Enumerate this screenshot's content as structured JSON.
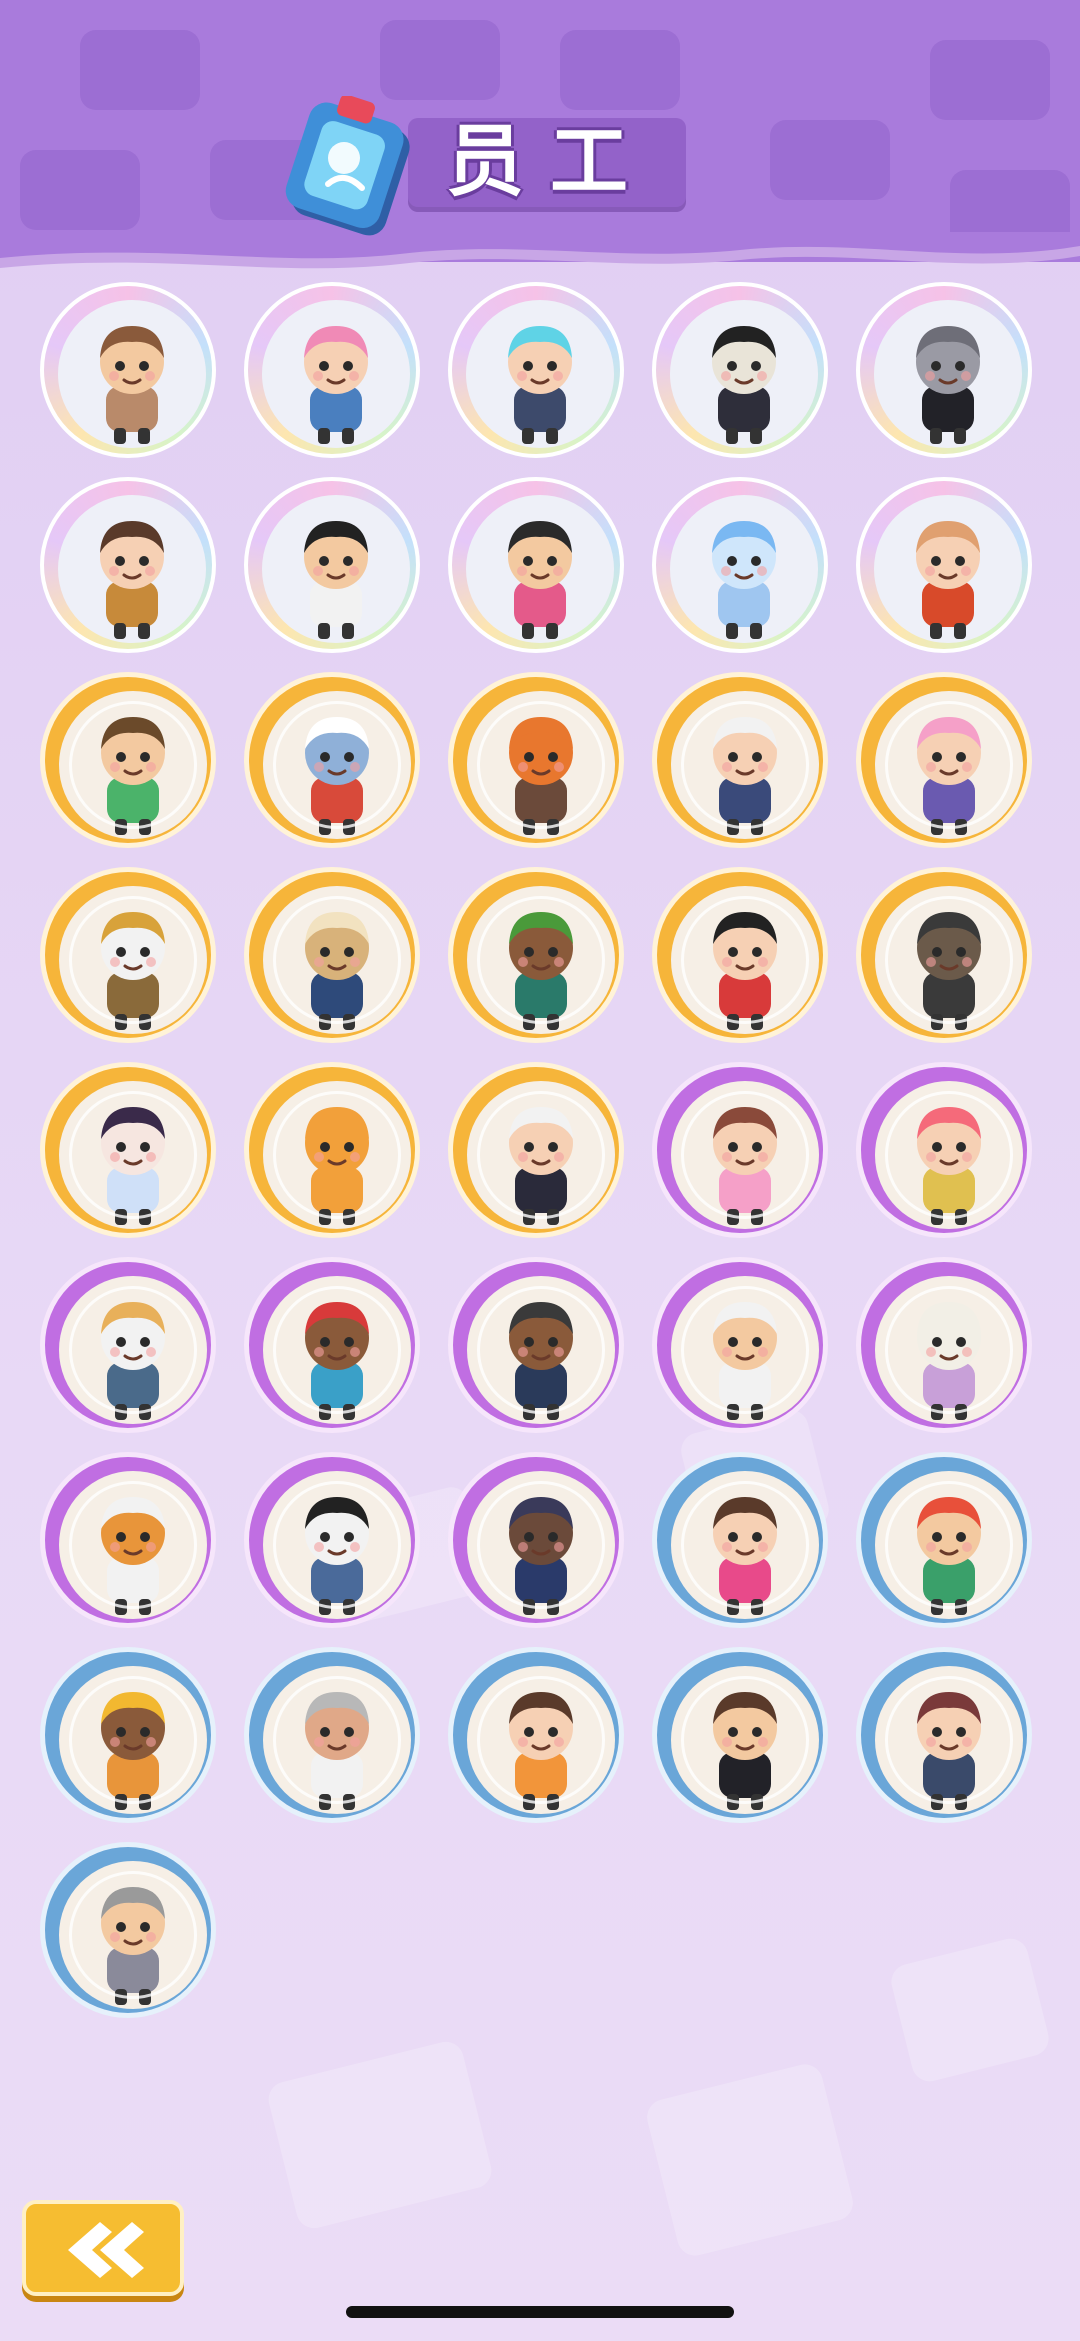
{
  "header": {
    "title": "员工",
    "icon": "staff-card-icon",
    "background_color": "#a97bdc"
  },
  "staff_grid": {
    "columns": 5,
    "items": [
      {
        "id": 1,
        "tier": "rainbow",
        "icon": "old-man-glasses-character",
        "skin": "#f3c9a0",
        "hair": "#8a5a3b",
        "outfit": "#b98a6a"
      },
      {
        "id": 2,
        "tier": "rainbow",
        "icon": "witch-girl-character",
        "skin": "#f6d0b4",
        "hair": "#f08ab6",
        "outfit": "#4a7fbf"
      },
      {
        "id": 3,
        "tier": "rainbow",
        "icon": "cyan-hair-swordsman-character",
        "skin": "#f6d0b4",
        "hair": "#5fd3e6",
        "outfit": "#3d4a6b"
      },
      {
        "id": 4,
        "tier": "rainbow",
        "icon": "jiangshi-character",
        "skin": "#e9e4d8",
        "hair": "#222222",
        "outfit": "#2e2e3a"
      },
      {
        "id": 5,
        "tier": "rainbow",
        "icon": "wolf-gentleman-character",
        "skin": "#9a9aa4",
        "hair": "#6e6e78",
        "outfit": "#222228"
      },
      {
        "id": 6,
        "tier": "rainbow",
        "icon": "cat-ear-girl-character",
        "skin": "#f6d0b4",
        "hair": "#5a3a2a",
        "outfit": "#c78a3a"
      },
      {
        "id": 7,
        "tier": "rainbow",
        "icon": "glasses-man-character",
        "skin": "#f3c9a0",
        "hair": "#222222",
        "outfit": "#f2f2f2"
      },
      {
        "id": 8,
        "tier": "rainbow",
        "icon": "bun-hair-chef-character",
        "skin": "#f3c9a0",
        "hair": "#2a2a2a",
        "outfit": "#e45a8a"
      },
      {
        "id": 9,
        "tier": "rainbow",
        "icon": "blue-ghost-girl-character",
        "skin": "#cfe6fb",
        "hair": "#7ab8f2",
        "outfit": "#9fc6f0"
      },
      {
        "id": 10,
        "tier": "rainbow",
        "icon": "twin-girls-character",
        "skin": "#f6d0b4",
        "hair": "#e0a070",
        "outfit": "#d84a2a"
      },
      {
        "id": 11,
        "tier": "gold",
        "icon": "elf-cloud-character",
        "skin": "#f3c9a0",
        "hair": "#6b4a2a",
        "outfit": "#4bb36a"
      },
      {
        "id": 12,
        "tier": "gold",
        "icon": "astronaut-fish-character",
        "skin": "#8fb0d8",
        "hair": "#ffffff",
        "outfit": "#d84a3a"
      },
      {
        "id": 13,
        "tier": "gold",
        "icon": "cooking-robot-character",
        "skin": "#e8772e",
        "hair": "#e8772e",
        "outfit": "#6b4a3a"
      },
      {
        "id": 14,
        "tier": "gold",
        "icon": "white-cat-girl-character",
        "skin": "#f6d0b4",
        "hair": "#f2f2f2",
        "outfit": "#3a4a7a"
      },
      {
        "id": 15,
        "tier": "gold",
        "icon": "pink-maid-character",
        "skin": "#f6d0b4",
        "hair": "#f5a0c8",
        "outfit": "#6a5ab0"
      },
      {
        "id": 16,
        "tier": "gold",
        "icon": "explorer-cat-character",
        "skin": "#f2f2f2",
        "hair": "#d8a23a",
        "outfit": "#8a6a3a"
      },
      {
        "id": 17,
        "tier": "gold",
        "icon": "fox-detective-character",
        "skin": "#d8b27a",
        "hair": "#f2e2c0",
        "outfit": "#2e4a7a"
      },
      {
        "id": 18,
        "tier": "gold",
        "icon": "bug-catcher-girl-character",
        "skin": "#8a5a3a",
        "hair": "#4a9a3a",
        "outfit": "#2a7a6a"
      },
      {
        "id": 19,
        "tier": "gold",
        "icon": "lion-dance-kid-character",
        "skin": "#f6d0b4",
        "hair": "#222222",
        "outfit": "#d83a3a"
      },
      {
        "id": 20,
        "tier": "gold",
        "icon": "bronze-statue-character",
        "skin": "#6b5a4a",
        "hair": "#3a3a3a",
        "outfit": "#3a3a3a"
      },
      {
        "id": 21,
        "tier": "gold",
        "icon": "umbrella-lady-character",
        "skin": "#f6e6e0",
        "hair": "#3a2a4a",
        "outfit": "#cfe0f8"
      },
      {
        "id": 22,
        "tier": "gold",
        "icon": "orange-robot-character",
        "skin": "#f2a03a",
        "hair": "#f2a03a",
        "outfit": "#f2a03a"
      },
      {
        "id": 23,
        "tier": "gold",
        "icon": "white-hair-boy-character",
        "skin": "#f6d0b4",
        "hair": "#f2f2f2",
        "outfit": "#2a2a3a"
      },
      {
        "id": 24,
        "tier": "purple",
        "icon": "ice-cream-girl-character",
        "skin": "#f6d0b4",
        "hair": "#8a4a3a",
        "outfit": "#f5a0c8"
      },
      {
        "id": 25,
        "tier": "purple",
        "icon": "pink-hair-girl-character",
        "skin": "#f6d0b4",
        "hair": "#f56a7a",
        "outfit": "#e0c050"
      },
      {
        "id": 26,
        "tier": "purple",
        "icon": "chef-cat-character",
        "skin": "#f2f2f2",
        "hair": "#e8b05a",
        "outfit": "#4a6a8a"
      },
      {
        "id": 27,
        "tier": "purple",
        "icon": "bandana-man-character",
        "skin": "#8a5a3a",
        "hair": "#d83a3a",
        "outfit": "#3aa0c8"
      },
      {
        "id": 28,
        "tier": "purple",
        "icon": "backpack-man-character",
        "skin": "#8a5a3a",
        "hair": "#3a3a3a",
        "outfit": "#2a3a5a"
      },
      {
        "id": 29,
        "tier": "purple",
        "icon": "chef-hat-man-character",
        "skin": "#f3c9a0",
        "hair": "#f2f2f2",
        "outfit": "#f2f2f2"
      },
      {
        "id": 30,
        "tier": "purple",
        "icon": "alpaca-character",
        "skin": "#f2efe6",
        "hair": "#f2efe6",
        "outfit": "#c8a0d8"
      },
      {
        "id": 31,
        "tier": "purple",
        "icon": "corgi-character",
        "skin": "#e8953a",
        "hair": "#f2f2f2",
        "outfit": "#f2f2f2"
      },
      {
        "id": 32,
        "tier": "purple",
        "icon": "panda-character",
        "skin": "#f2f2f2",
        "hair": "#222222",
        "outfit": "#4a6a9a"
      },
      {
        "id": 33,
        "tier": "purple",
        "icon": "otter-explorer-character",
        "skin": "#6b4a3a",
        "hair": "#3a3a5a",
        "outfit": "#2a3a6a"
      },
      {
        "id": 34,
        "tier": "blue",
        "icon": "curly-hair-woman-character",
        "skin": "#f6d0b4",
        "hair": "#5a3a2a",
        "outfit": "#e84a8a"
      },
      {
        "id": 35,
        "tier": "blue",
        "icon": "red-hair-boy-character",
        "skin": "#f3c9a0",
        "hair": "#e8503a",
        "outfit": "#3aa06a"
      },
      {
        "id": 36,
        "tier": "blue",
        "icon": "worker-boy-character",
        "skin": "#8a5a3a",
        "hair": "#f2b830",
        "outfit": "#e8953a"
      },
      {
        "id": 37,
        "tier": "blue",
        "icon": "old-man-cup-character",
        "skin": "#e0a888",
        "hair": "#b8b8b8",
        "outfit": "#f2f2f2"
      },
      {
        "id": 38,
        "tier": "blue",
        "icon": "angry-girl-character",
        "skin": "#f6d0b4",
        "hair": "#5a3a2a",
        "outfit": "#f2953a"
      },
      {
        "id": 39,
        "tier": "blue",
        "icon": "beanie-man-character",
        "skin": "#f3c9a0",
        "hair": "#5a3a2a",
        "outfit": "#222228"
      },
      {
        "id": 40,
        "tier": "blue",
        "icon": "glasses-girl-character",
        "skin": "#f6d0b4",
        "hair": "#7a3a3a",
        "outfit": "#3a4a6a"
      },
      {
        "id": 41,
        "tier": "blue",
        "icon": "bald-worker-character",
        "skin": "#f3c9a0",
        "hair": "#9a9a9a",
        "outfit": "#8a8a9a"
      }
    ]
  },
  "footer": {
    "back_icon": "chevron-left-icon"
  },
  "colors": {
    "gold_ring": "#f6b53a",
    "purple_ring": "#c06ee2",
    "blue_ring": "#6aa6d8",
    "back_button": "#f6bd31"
  }
}
